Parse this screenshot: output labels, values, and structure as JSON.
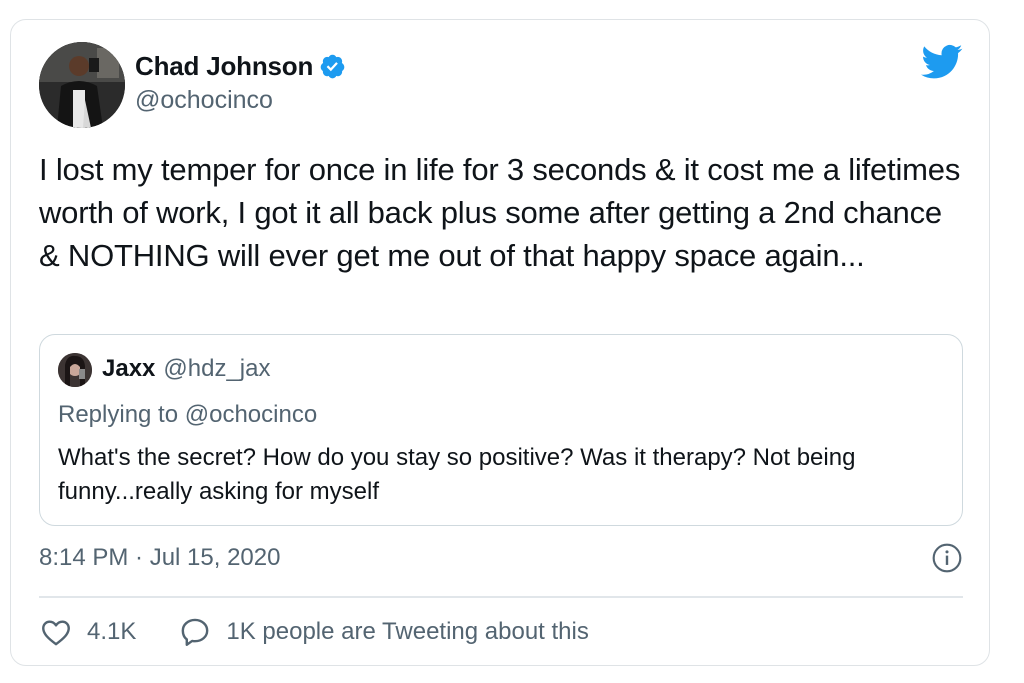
{
  "tweet": {
    "author_name": "Chad Johnson",
    "author_handle": "@ochocinco",
    "verified": true,
    "text": "I lost my temper for once in life for 3 seconds & it cost me a lifetimes worth of work, I got it all back plus some after getting a 2nd chance & NOTHING will ever get me out of that happy space again...",
    "timestamp": "8:14 PM · Jul 15, 2020"
  },
  "quote": {
    "author_name": "Jaxx",
    "author_handle": "@hdz_jax",
    "replying_to": "Replying to @ochocinco",
    "text": "What's the secret? How do you stay so positive? Was it therapy? Not being funny...really asking for myself"
  },
  "actions": {
    "like_count": "4.1K",
    "conversation_label": "1K people are Tweeting about this"
  },
  "icons": {
    "brand": "twitter-bird-icon",
    "verified": "verified-badge-icon",
    "info": "info-icon",
    "like": "heart-icon",
    "reply": "speech-bubble-icon"
  },
  "colors": {
    "brand_blue": "#1d9bf0",
    "text_primary": "#0f1419",
    "text_secondary": "#536471",
    "border": "#dfe3e6"
  }
}
